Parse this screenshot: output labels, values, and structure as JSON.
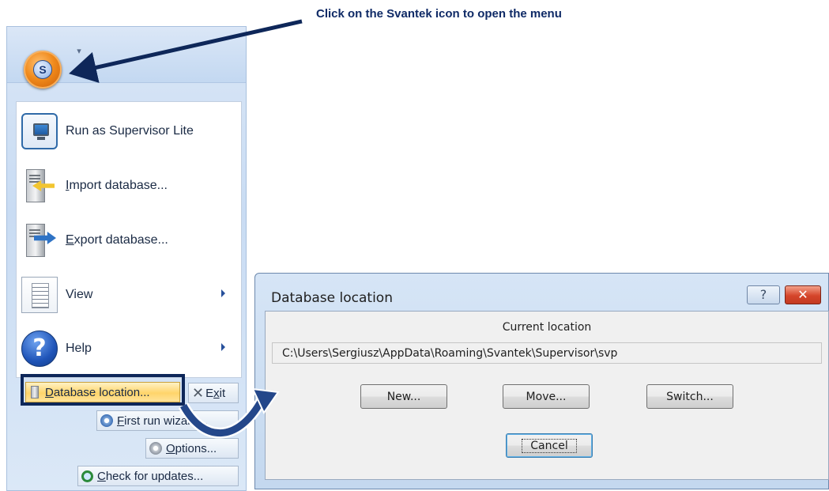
{
  "callout": {
    "text": "Click on the Svantek icon to open the menu"
  },
  "app_menu": {
    "quick_access_glyph": "▾",
    "items": [
      {
        "label": "Run as Supervisor Lite",
        "icon": "monitor-icon"
      },
      {
        "label": "Import database...",
        "icon": "import-database-icon",
        "accel": "I",
        "rest": "mport database..."
      },
      {
        "label": "Export database...",
        "icon": "export-database-icon",
        "accel": "E",
        "rest": "xport database..."
      },
      {
        "label": "View",
        "icon": "document-view-icon",
        "submenu": true
      },
      {
        "label": "Help",
        "icon": "help-icon",
        "submenu": true
      }
    ],
    "buttons": {
      "database_location": {
        "accel": "D",
        "rest": "atabase location..."
      },
      "exit": {
        "pre": "E",
        "accel": "x",
        "rest": "it"
      },
      "first_run_wizard": {
        "accel": "F",
        "rest": "irst run wizard..."
      },
      "options": {
        "accel": "O",
        "rest": "ptions..."
      },
      "check_updates": {
        "accel": "C",
        "rest": "heck for updates..."
      }
    }
  },
  "dialog": {
    "title": "Database location",
    "help_glyph": "?",
    "close_glyph": "✕",
    "current_location_label": "Current location",
    "current_path": "C:\\Users\\Sergiusz\\AppData\\Roaming\\Svantek\\Supervisor\\svp",
    "buttons": {
      "new": "New...",
      "move": "Move...",
      "switch": "Switch...",
      "cancel": "Cancel"
    }
  },
  "colors": {
    "annotation": "#0e2759",
    "highlight_button": "#ffd46a",
    "dialog_frame": "#c4d8ef"
  }
}
